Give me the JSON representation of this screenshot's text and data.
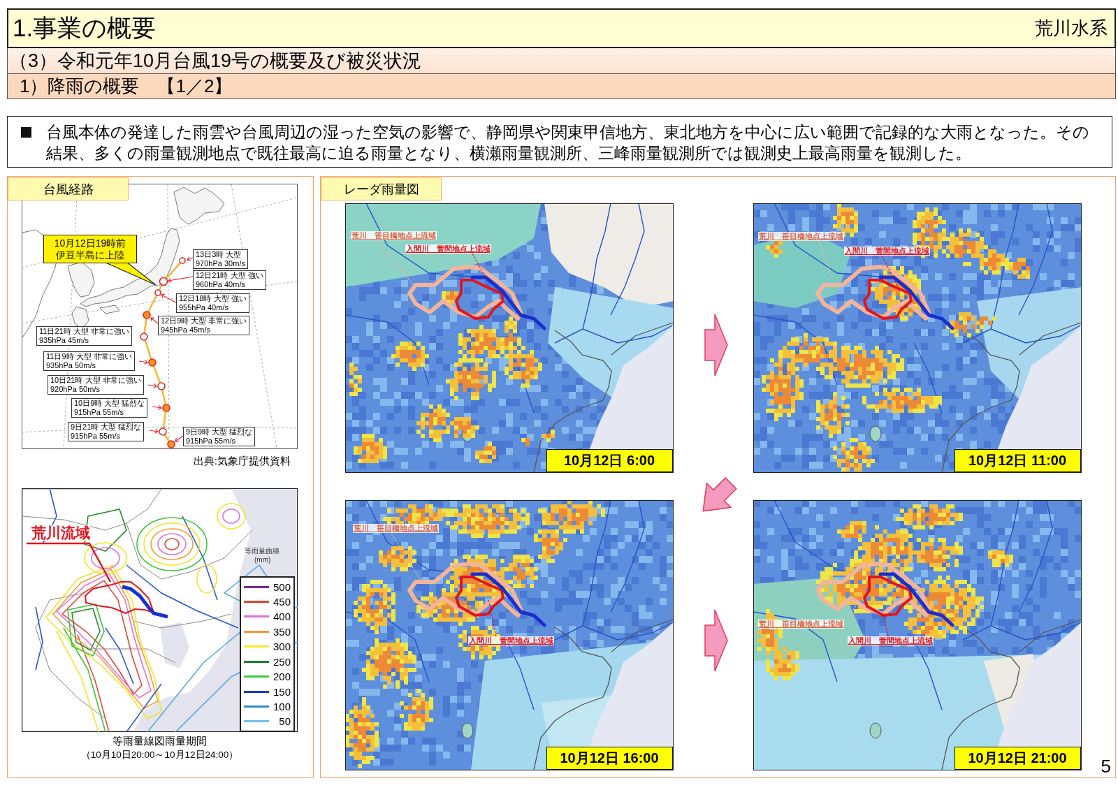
{
  "header": {
    "title": "1.事業の概要",
    "river_system": "荒川水系"
  },
  "section": "（3）令和元年10月台風19号の概要及び被災状況",
  "subsection": "1）降雨の概要　【1／2】",
  "summary": "台風本体の発達した雨雲や台風周辺の湿った空気の影響で、静岡県や関東甲信地方、東北地方を中心に広い範囲で記録的な大雨となった。その結果、多くの雨量観測地点で既往最高に迫る雨量となり、横瀬雨量観測所、三峰雨量観測所では観測史上最高雨量を観測した。",
  "typhoon_panel": {
    "heading": "台風経路",
    "callout": [
      "10月12日19時前",
      "伊豆半島に上陸"
    ],
    "points": [
      {
        "lines": [
          "13日3時 大型",
          "970hPa 30m/s"
        ],
        "filled": false
      },
      {
        "lines": [
          "12日21時 大型 強い",
          "960hPa 40m/s"
        ],
        "filled": false
      },
      {
        "lines": [
          "12日18時 大型 強い",
          "955hPa 40m/s"
        ],
        "filled": false
      },
      {
        "lines": [
          "12日9時 大型 非常に強い",
          "945hPa 45m/s"
        ],
        "filled": true
      },
      {
        "lines": [
          "11日21時 大型 非常に強い",
          "935hPa 45m/s"
        ],
        "filled": false
      },
      {
        "lines": [
          "11日9時 大型 非常に強い",
          "935hPa 50m/s"
        ],
        "filled": true
      },
      {
        "lines": [
          "10日21時 大型 非常に強い",
          "920hPa 50m/s"
        ],
        "filled": false
      },
      {
        "lines": [
          "10日9時 大型 猛烈な",
          "915hPa 55m/s"
        ],
        "filled": true
      },
      {
        "lines": [
          "9日21時 大型 猛烈な",
          "915hPa 55m/s"
        ],
        "filled": false
      },
      {
        "lines": [
          "9日9時 大型 猛烈な",
          "915hPa 55m/s"
        ],
        "filled": true
      }
    ],
    "source": "出典:気象庁提供資料",
    "rainfall_map": {
      "basin_label": "荒川流域",
      "legend_title": "等雨量曲線",
      "legend_unit": "(mm)",
      "legend": [
        {
          "value": "500",
          "color": "#7a2a9a"
        },
        {
          "value": "450",
          "color": "#e0402a"
        },
        {
          "value": "400",
          "color": "#e070e0"
        },
        {
          "value": "350",
          "color": "#f09a30"
        },
        {
          "value": "300",
          "color": "#f2ea2a"
        },
        {
          "value": "250",
          "color": "#1f7a2a"
        },
        {
          "value": "200",
          "color": "#3ccf3c"
        },
        {
          "value": "150",
          "color": "#1a36c0"
        },
        {
          "value": "100",
          "color": "#2a8ad8"
        },
        {
          "value": "50",
          "color": "#6cc0ec"
        }
      ],
      "caption": "等雨量線図雨量期間",
      "period": "（10月10日20:00～10月12日24:00）"
    }
  },
  "radar_panel": {
    "heading": "レーダ雨量図",
    "maps": [
      {
        "basin_labels": [
          "荒川　笹目橋地点上流域",
          "入間川　菅間地点上流域"
        ],
        "time": "10月12日 6:00"
      },
      {
        "basin_labels": [
          "荒川　笹目橋地点上流域",
          "入間川　菅間地点上流域"
        ],
        "time": "10月12日 11:00"
      },
      {
        "basin_labels": [
          "荒川　笹目橋地点上流域",
          "入間川　菅間地点上流域"
        ],
        "time": "10月12日 16:00"
      },
      {
        "basin_labels": [
          "荒川　笹目橋地点上流域",
          "入間川　菅間地点上流域"
        ],
        "time": "10月12日 21:00"
      }
    ]
  },
  "page_number": "5"
}
